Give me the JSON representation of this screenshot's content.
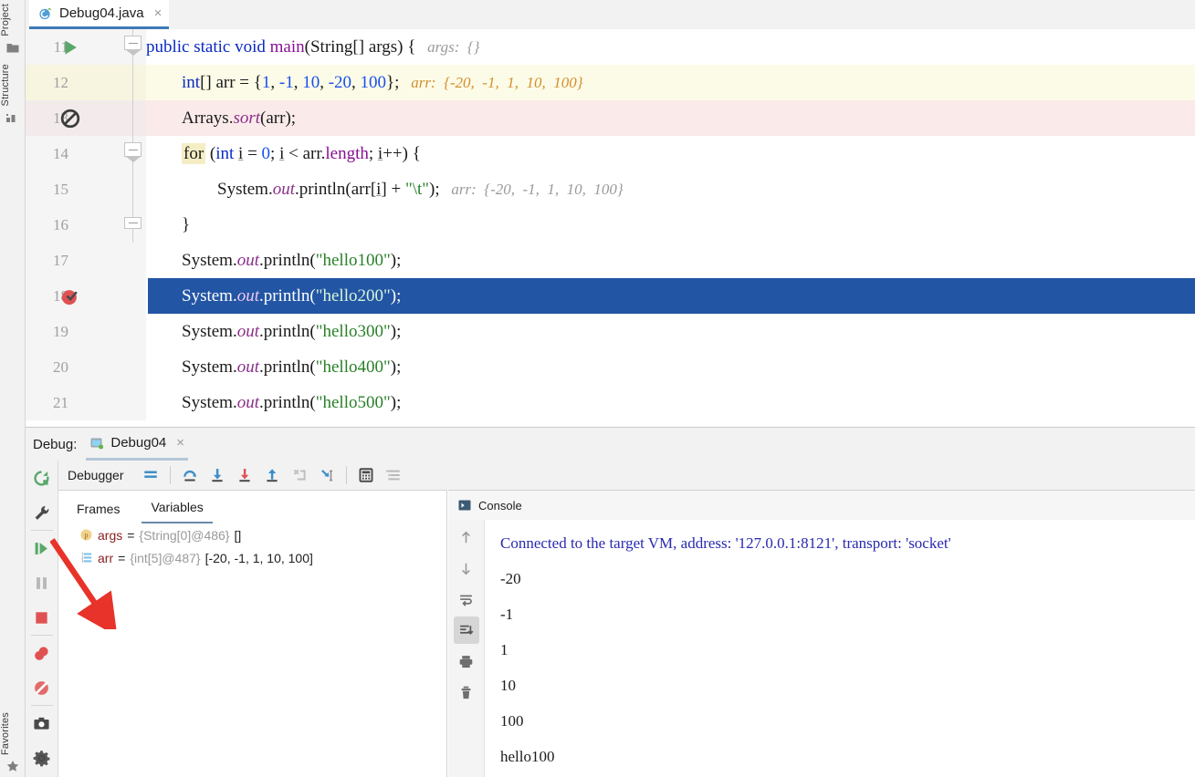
{
  "rail": {
    "top_items": [
      {
        "label": "Project",
        "icon": "folder-icon"
      },
      {
        "label": "Structure",
        "icon": "structure-icon"
      }
    ],
    "bottom_items": [
      {
        "label": "Favorites",
        "icon": "star-icon"
      }
    ]
  },
  "editor_tab": {
    "filename": "Debug04.java",
    "icon": "java-class-icon",
    "close": "×"
  },
  "editor": {
    "lines": [
      {
        "number": "11",
        "gutter_icon": "run-play-icon",
        "fold": "fold-collapse-arrow",
        "bg": "none",
        "indent": 0,
        "tokens": [
          {
            "t": "public ",
            "c": "kw"
          },
          {
            "t": "static ",
            "c": "kw"
          },
          {
            "t": "void ",
            "c": "kw"
          },
          {
            "t": "main",
            "c": "fld"
          },
          {
            "t": "(String[] args) {",
            "c": ""
          }
        ],
        "hint": "args:  {}",
        "hint_color": "gray"
      },
      {
        "number": "12",
        "gutter_icon": "none",
        "fold": "none",
        "bg": "yellow",
        "indent": 1,
        "tokens": [
          {
            "t": "int",
            "c": "kw"
          },
          {
            "t": "[] arr = {",
            "c": ""
          },
          {
            "t": "1",
            "c": "num"
          },
          {
            "t": ", ",
            "c": ""
          },
          {
            "t": "-1",
            "c": "num"
          },
          {
            "t": ", ",
            "c": ""
          },
          {
            "t": "10",
            "c": "num"
          },
          {
            "t": ", ",
            "c": ""
          },
          {
            "t": "-20",
            "c": "num"
          },
          {
            "t": ", ",
            "c": ""
          },
          {
            "t": "100",
            "c": "num"
          },
          {
            "t": "};",
            "c": ""
          }
        ],
        "hint": "arr:  {-20,  -1,  1,  10,  100}",
        "hint_color": "orange"
      },
      {
        "number": "13",
        "gutter_icon": "breakpoint-disabled-icon",
        "fold": "none",
        "bg": "pink",
        "indent": 1,
        "tokens": [
          {
            "t": "Arrays.",
            "c": ""
          },
          {
            "t": "sort",
            "c": "stat"
          },
          {
            "t": "(arr);",
            "c": ""
          }
        ],
        "hint": "",
        "hint_color": "gray"
      },
      {
        "number": "14",
        "gutter_icon": "none",
        "fold": "fold-collapse-arrow",
        "bg": "none",
        "indent": 1,
        "tokens": [
          {
            "t": "for",
            "c": "forkw"
          },
          {
            "t": " (",
            "c": ""
          },
          {
            "t": "int ",
            "c": "kw"
          },
          {
            "t": "i",
            "c": "und"
          },
          {
            "t": " = ",
            "c": ""
          },
          {
            "t": "0",
            "c": "num"
          },
          {
            "t": "; ",
            "c": ""
          },
          {
            "t": "i",
            "c": "und"
          },
          {
            "t": " < arr.",
            "c": ""
          },
          {
            "t": "length",
            "c": "fld"
          },
          {
            "t": "; ",
            "c": ""
          },
          {
            "t": "i",
            "c": "und"
          },
          {
            "t": "++) {",
            "c": ""
          }
        ],
        "hint": "",
        "hint_color": "gray"
      },
      {
        "number": "15",
        "gutter_icon": "none",
        "fold": "none",
        "bg": "none",
        "indent": 2,
        "tokens": [
          {
            "t": "System.",
            "c": ""
          },
          {
            "t": "out",
            "c": "stat"
          },
          {
            "t": ".println(arr[",
            "c": ""
          },
          {
            "t": "i",
            "c": "und"
          },
          {
            "t": "] + ",
            "c": ""
          },
          {
            "t": "\"\\t\"",
            "c": "str"
          },
          {
            "t": ");",
            "c": ""
          }
        ],
        "hint": "arr:  {-20,  -1,  1,  10,  100}",
        "hint_color": "gray"
      },
      {
        "number": "16",
        "gutter_icon": "none",
        "fold": "fold-end",
        "bg": "none",
        "indent": 1,
        "tokens": [
          {
            "t": "}",
            "c": ""
          }
        ],
        "hint": "",
        "hint_color": "gray"
      },
      {
        "number": "17",
        "gutter_icon": "none",
        "fold": "none",
        "bg": "none",
        "indent": 1,
        "tokens": [
          {
            "t": "System.",
            "c": ""
          },
          {
            "t": "out",
            "c": "stat"
          },
          {
            "t": ".println(",
            "c": ""
          },
          {
            "t": "\"hello100\"",
            "c": "str"
          },
          {
            "t": ");",
            "c": ""
          }
        ],
        "hint": "",
        "hint_color": "gray"
      },
      {
        "number": "18",
        "gutter_icon": "breakpoint-verified-icon",
        "fold": "none",
        "bg": "selected",
        "indent": 1,
        "tokens": [
          {
            "t": "System.",
            "c": ""
          },
          {
            "t": "out",
            "c": "stat"
          },
          {
            "t": ".println(",
            "c": ""
          },
          {
            "t": "\"hello200\"",
            "c": "str"
          },
          {
            "t": ");",
            "c": ""
          }
        ],
        "hint": "",
        "hint_color": "gray"
      },
      {
        "number": "19",
        "gutter_icon": "none",
        "fold": "none",
        "bg": "none",
        "indent": 1,
        "tokens": [
          {
            "t": "System.",
            "c": ""
          },
          {
            "t": "out",
            "c": "stat"
          },
          {
            "t": ".println(",
            "c": ""
          },
          {
            "t": "\"hello300\"",
            "c": "str"
          },
          {
            "t": ");",
            "c": ""
          }
        ],
        "hint": "",
        "hint_color": "gray"
      },
      {
        "number": "20",
        "gutter_icon": "none",
        "fold": "none",
        "bg": "none",
        "indent": 1,
        "tokens": [
          {
            "t": "System.",
            "c": ""
          },
          {
            "t": "out",
            "c": "stat"
          },
          {
            "t": ".println(",
            "c": ""
          },
          {
            "t": "\"hello400\"",
            "c": "str"
          },
          {
            "t": ");",
            "c": ""
          }
        ],
        "hint": "",
        "hint_color": "gray"
      },
      {
        "number": "21",
        "gutter_icon": "none",
        "fold": "none",
        "bg": "none",
        "indent": 1,
        "tokens": [
          {
            "t": "System.",
            "c": ""
          },
          {
            "t": "out",
            "c": "stat"
          },
          {
            "t": ".println(",
            "c": ""
          },
          {
            "t": "\"hello500\"",
            "c": "str"
          },
          {
            "t": ");",
            "c": ""
          }
        ],
        "hint": "",
        "hint_color": "gray"
      }
    ]
  },
  "debug": {
    "header_label": "Debug:",
    "tab_name": "Debug04",
    "tab_icon": "run-config-icon",
    "tab_close": "×",
    "actions": [
      {
        "name": "rerun-button",
        "icon": "rerun-icon"
      },
      {
        "name": "settings-button",
        "icon": "wrench-icon"
      },
      {
        "name": "resume-button",
        "icon": "resume-icon"
      },
      {
        "name": "pause-button",
        "icon": "pause-icon"
      },
      {
        "name": "stop-button",
        "icon": "stop-icon"
      },
      {
        "name": "view-breakpoints-button",
        "icon": "breakpoints-icon"
      },
      {
        "name": "mute-breakpoints-button",
        "icon": "mute-breakpoints-icon"
      },
      {
        "name": "screenshot-button",
        "icon": "camera-icon"
      },
      {
        "name": "layout-settings-button",
        "icon": "gear-icon"
      }
    ],
    "toolbar_label": "Debugger",
    "toolbar_buttons": [
      {
        "name": "show-execution-point-button",
        "icon": "execution-point-icon"
      },
      {
        "name": "step-over-button",
        "icon": "step-over-icon"
      },
      {
        "name": "step-into-button",
        "icon": "step-into-icon"
      },
      {
        "name": "force-step-into-button",
        "icon": "force-step-into-icon"
      },
      {
        "name": "step-out-button",
        "icon": "step-out-icon"
      },
      {
        "name": "drop-frame-button",
        "icon": "drop-frame-icon"
      },
      {
        "name": "run-to-cursor-button",
        "icon": "run-to-cursor-icon"
      },
      {
        "name": "evaluate-expression-button",
        "icon": "calculator-icon"
      },
      {
        "name": "settings-button",
        "icon": "list-settings-icon"
      }
    ],
    "tabs": [
      {
        "label": "Frames",
        "active": false
      },
      {
        "label": "Variables",
        "active": true
      }
    ],
    "variables": [
      {
        "expandable": false,
        "icon": "parameter-icon",
        "name": "args",
        "ref": "{String[0]@486}",
        "value": "[]"
      },
      {
        "expandable": true,
        "icon": "array-icon",
        "name": "arr",
        "ref": "{int[5]@487}",
        "value": "[-20, -1, 1, 10, 100]"
      }
    ]
  },
  "console": {
    "title": "Console",
    "icon": "console-icon",
    "side_buttons": [
      {
        "name": "scroll-up-button",
        "icon": "arrow-up-icon",
        "active": false
      },
      {
        "name": "scroll-down-button",
        "icon": "arrow-down-icon",
        "active": false
      },
      {
        "name": "soft-wrap-button",
        "icon": "soft-wrap-icon",
        "active": false
      },
      {
        "name": "scroll-to-end-button",
        "icon": "scroll-to-end-icon",
        "active": true
      },
      {
        "name": "print-button",
        "icon": "printer-icon",
        "active": false
      },
      {
        "name": "clear-all-button",
        "icon": "trash-icon",
        "active": false
      }
    ],
    "output": [
      {
        "text": "Connected to the target VM, address: '127.0.0.1:8121', transport: 'socket'",
        "link": true
      },
      {
        "text": "-20",
        "link": false
      },
      {
        "text": "-1",
        "link": false
      },
      {
        "text": "1",
        "link": false
      },
      {
        "text": "10",
        "link": false
      },
      {
        "text": "100",
        "link": false
      },
      {
        "text": "hello100",
        "link": false
      }
    ]
  },
  "annotation": {
    "arrow": "red-arrow-annotation",
    "color": "#e8332a"
  }
}
